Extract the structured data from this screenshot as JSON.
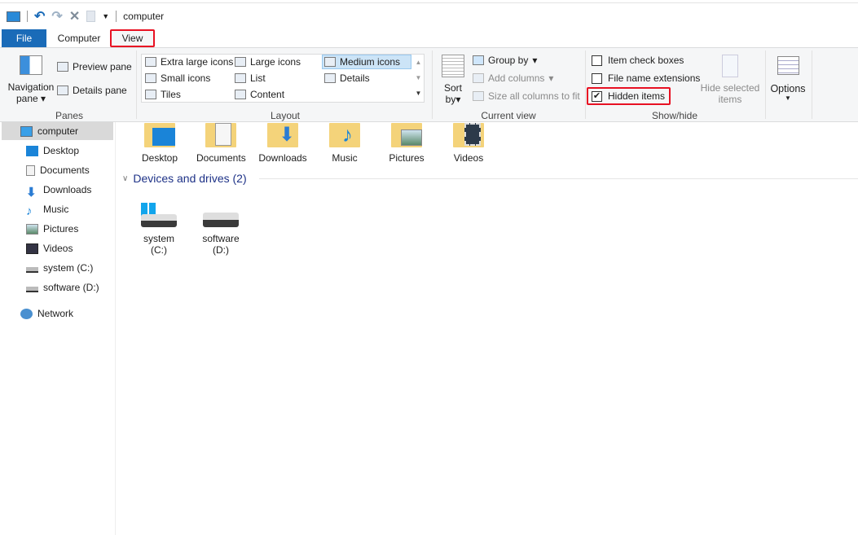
{
  "window": {
    "title": "computer"
  },
  "quick_access": {
    "icons": [
      "computer-icon",
      "undo-icon",
      "redo-icon",
      "delete-icon",
      "properties-icon",
      "customize-dropdown-icon"
    ]
  },
  "tabs": [
    {
      "label": "File"
    },
    {
      "label": "Computer"
    },
    {
      "label": "View"
    }
  ],
  "ribbon": {
    "panes": {
      "group": "Panes",
      "navigation_pane": "Navigation",
      "navigation_pane2": "pane",
      "preview_pane": "Preview pane",
      "details_pane": "Details pane"
    },
    "layout": {
      "group": "Layout",
      "items": [
        "Extra large icons",
        "Large icons",
        "Medium icons",
        "Small icons",
        "List",
        "Details",
        "Tiles",
        "Content"
      ],
      "selected": "Medium icons"
    },
    "current_view": {
      "group": "Current view",
      "sort_by": "Sort",
      "sort_by2": "by",
      "group_by": "Group by",
      "add_columns": "Add columns",
      "size_columns": "Size all columns to fit"
    },
    "show_hide": {
      "group": "Show/hide",
      "item_check_boxes": "Item check boxes",
      "file_name_extensions": "File name extensions",
      "hidden_items": "Hidden items",
      "hide_selected": "Hide selected",
      "hide_selected2": "items",
      "checked": {
        "item_check_boxes": false,
        "file_name_extensions": false,
        "hidden_items": true
      }
    },
    "options": {
      "label": "Options"
    }
  },
  "nav": {
    "items": [
      "computer",
      "Desktop",
      "Documents",
      "Downloads",
      "Music",
      "Pictures",
      "Videos",
      "system (C:)",
      "software (D:)",
      "Network"
    ]
  },
  "content": {
    "folders": [
      "Desktop",
      "Documents",
      "Downloads",
      "Music",
      "Pictures",
      "Videos"
    ],
    "devices_header": "Devices and drives (2)",
    "drives": [
      {
        "label": "system (C:)"
      },
      {
        "label": "software",
        "label2": "(D:)"
      }
    ]
  },
  "colors": {
    "accent": "#1a6bb8",
    "highlight": "#e81123",
    "header_blue": "#1e3287"
  }
}
